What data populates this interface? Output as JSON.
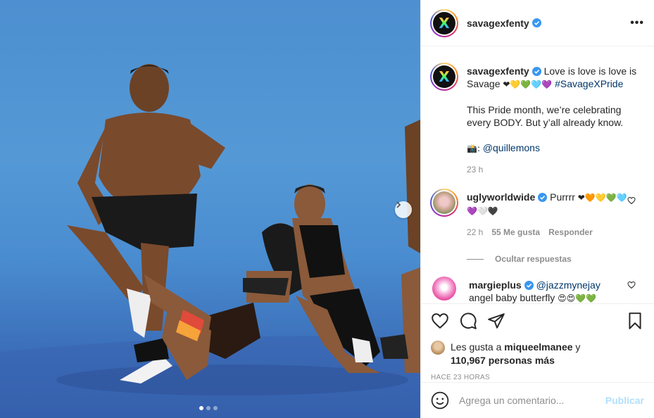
{
  "post": {
    "username": "savagexfenty",
    "more_icon": "•••",
    "caption_user": "savagexfenty",
    "caption_line1": " Love is love is love is Savage ",
    "caption_emojis": "❤💛💚🩵💜",
    "caption_hashtag": "#SavageXPride",
    "caption_para2": "This Pride month, we’re celebrating every BODY. But y’all already know.",
    "photo_credit_emoji": "📸: ",
    "photo_credit_handle": "@quillemons",
    "caption_time": "23 h"
  },
  "comments": [
    {
      "username": "uglyworldwide",
      "text": " Purrrr ",
      "emojis": "❤🧡💛💚🩵💜🤍🖤",
      "time": "22 h",
      "likes": "55 Me gusta",
      "reply": "Responder"
    },
    {
      "username": "margieplus",
      "mention": "@jazzmynejay",
      "text": "angel baby butterfly ",
      "emojis": "😍😍💚💚"
    }
  ],
  "hide_replies": "Ocultar respuestas",
  "likes": {
    "prefix": "Les gusta a ",
    "user": "miqueelmanee",
    "mid": " y",
    "others": "110,967 personas más"
  },
  "timestamp": "HACE 23 HORAS",
  "add_comment": {
    "placeholder": "Agrega un comentario...",
    "post_label": "Publicar"
  },
  "carousel": {
    "slides": 3,
    "active": 1
  },
  "icons": {
    "like": "heart-icon",
    "comment": "comment-icon",
    "share": "share-icon",
    "save": "bookmark-icon",
    "emoji": "emoji-icon",
    "next": "chevron-right-icon",
    "verified": "verified-badge-icon"
  },
  "colors": {
    "link": "#00376b",
    "verified": "#3897f0",
    "post_button_disabled": "#b2dffc",
    "secondary_text": "#8e8e8e"
  }
}
